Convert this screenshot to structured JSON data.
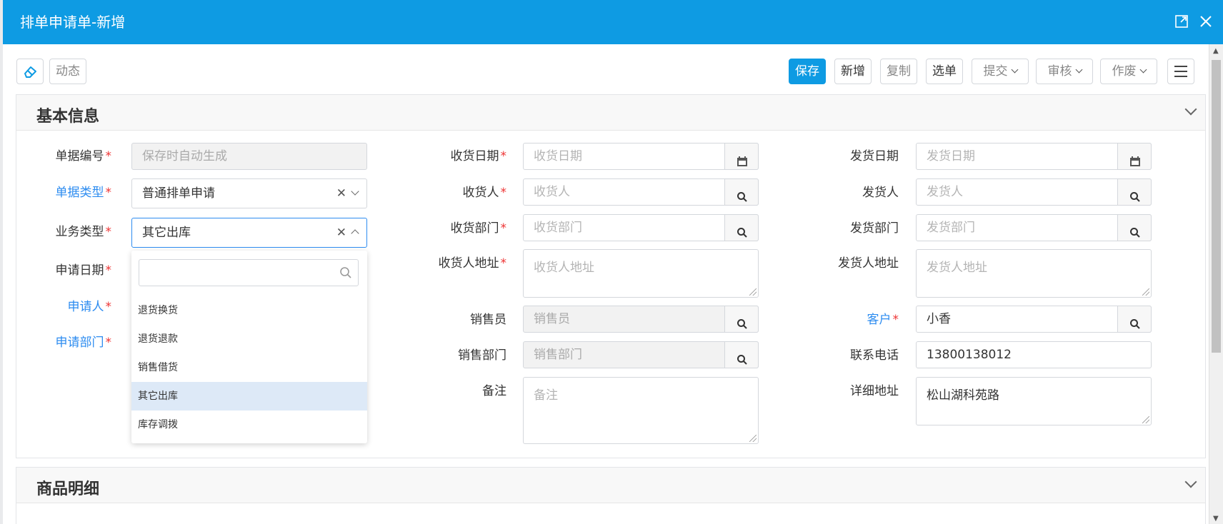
{
  "dialog": {
    "title": "排单申请单-新增"
  },
  "toolbar": {
    "dynamic": "动态",
    "save": "保存",
    "new": "新增",
    "copy": "复制",
    "select": "选单",
    "submit": "提交",
    "audit": "审核",
    "void": "作废"
  },
  "sections": {
    "basic": "基本信息",
    "goods": "商品明细"
  },
  "form": {
    "doc_no": {
      "label": "单据编号",
      "placeholder": "保存时自动生成"
    },
    "doc_type": {
      "label": "单据类型",
      "value": "普通排单申请"
    },
    "biz_type": {
      "label": "业务类型",
      "value": "其它出库"
    },
    "apply_date": {
      "label": "申请日期"
    },
    "applicant": {
      "label": "申请人"
    },
    "apply_dept": {
      "label": "申请部门"
    },
    "recv_date": {
      "label": "收货日期",
      "placeholder": "收货日期"
    },
    "receiver": {
      "label": "收货人",
      "placeholder": "收货人"
    },
    "recv_dept": {
      "label": "收货部门",
      "placeholder": "收货部门"
    },
    "recv_addr": {
      "label": "收货人地址",
      "placeholder": "收货人地址"
    },
    "salesman": {
      "label": "销售员",
      "placeholder": "销售员"
    },
    "sales_dept": {
      "label": "销售部门",
      "placeholder": "销售部门"
    },
    "remark": {
      "label": "备注",
      "placeholder": "备注"
    },
    "ship_date": {
      "label": "发货日期",
      "placeholder": "发货日期"
    },
    "shipper": {
      "label": "发货人",
      "placeholder": "发货人"
    },
    "ship_dept": {
      "label": "发货部门",
      "placeholder": "发货部门"
    },
    "ship_addr": {
      "label": "发货人地址",
      "placeholder": "发货人地址"
    },
    "customer": {
      "label": "客户",
      "value": "小香"
    },
    "phone": {
      "label": "联系电话",
      "value": "13800138012"
    },
    "detail_addr": {
      "label": "详细地址",
      "value": "松山湖科苑路"
    }
  },
  "dropdown": {
    "items": [
      "退货换货",
      "退货退款",
      "销售借货",
      "其它出库",
      "库存调拨"
    ],
    "selected": "其它出库"
  },
  "colors": {
    "primary": "#0e9be3",
    "required": "#e33333",
    "link_label": "#2d8cf0"
  },
  "required_mark": "*"
}
